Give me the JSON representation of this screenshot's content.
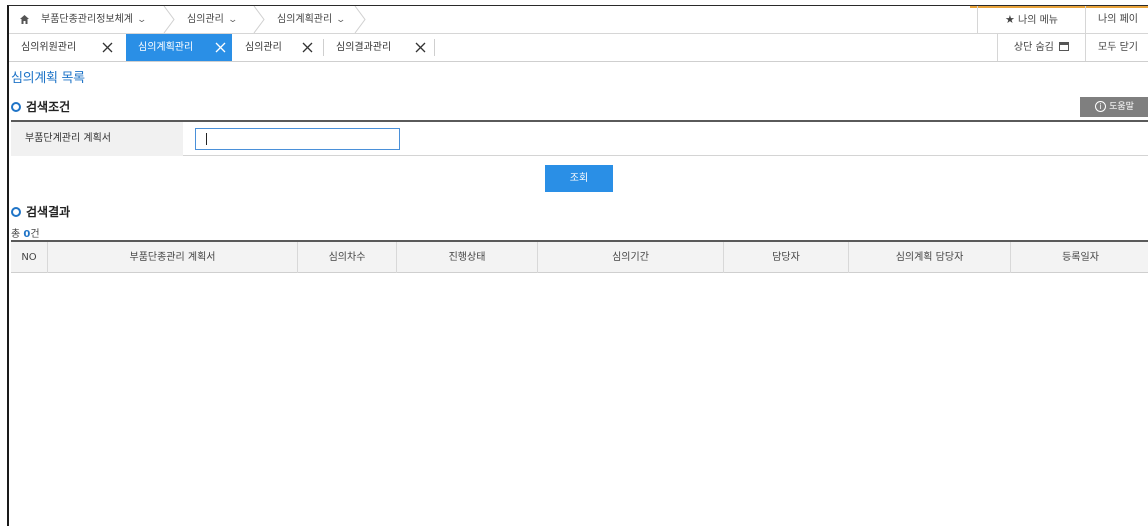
{
  "breadcrumb": {
    "items": [
      {
        "label": "부품단종관리정보체계"
      },
      {
        "label": "심의관리"
      },
      {
        "label": "심의계획관리"
      }
    ]
  },
  "top_menu": {
    "my_menu": "나의 메뉴",
    "my_page": "나의 페이"
  },
  "tabs": [
    {
      "label": "심의위원관리",
      "active": false
    },
    {
      "label": "심의계획관리",
      "active": true
    },
    {
      "label": "심의관리",
      "active": false
    },
    {
      "label": "심의결과관리",
      "active": false
    }
  ],
  "tab_actions": {
    "hide_top": "상단 숨김",
    "close_all": "모두 닫기"
  },
  "page": {
    "title": "심의계획 목록"
  },
  "search": {
    "section_title": "검색조건",
    "help_label": "도움말",
    "field_label": "부품단계관리 계획서",
    "field_value": "",
    "query_button": "조회"
  },
  "results": {
    "section_title": "검색결과",
    "count_prefix": "총 ",
    "count_value": "0",
    "count_suffix": "건",
    "columns": [
      "NO",
      "부품단종관리 계획서",
      "심의차수",
      "진행상태",
      "심의기간",
      "담당자",
      "심의계획 담당자",
      "등록일자"
    ],
    "rows": []
  },
  "colors": {
    "accent": "#2a8fe6",
    "title_blue": "#1f74c7",
    "help_gray": "#7f7f7f"
  }
}
